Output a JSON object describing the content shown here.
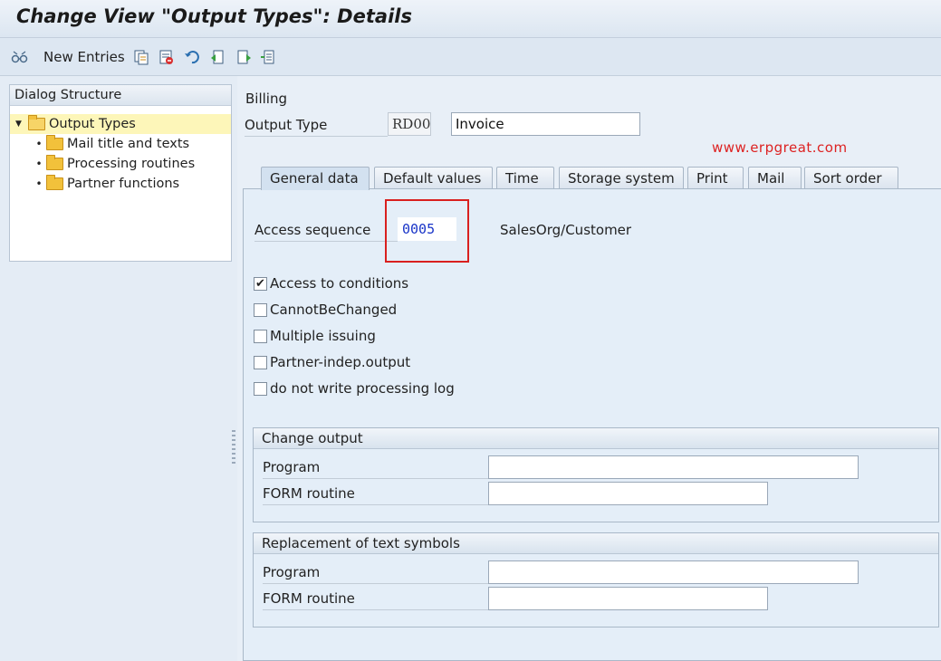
{
  "window": {
    "title": "Change View \"Output Types\": Details"
  },
  "toolbar": {
    "new_entries_label": "New Entries",
    "icons": [
      "glasses-change-icon",
      "copy-icon",
      "delete-icon",
      "undo-icon",
      "previous-entry-icon",
      "next-entry-icon",
      "select-all-icon"
    ]
  },
  "dialog_structure": {
    "header": "Dialog Structure",
    "items": [
      {
        "label": "Output Types",
        "level": 0,
        "selected": true,
        "expanded": true
      },
      {
        "label": "Mail title and texts",
        "level": 1
      },
      {
        "label": "Processing routines",
        "level": 1
      },
      {
        "label": "Partner functions",
        "level": 1
      }
    ]
  },
  "header": {
    "application": "Billing",
    "output_type_label": "Output Type",
    "output_type_code": "RD00",
    "output_type_desc": "Invoice"
  },
  "watermark": "www.erpgreat.com",
  "tabs": [
    {
      "label": "General data",
      "active": true
    },
    {
      "label": "Default values"
    },
    {
      "label": "Time"
    },
    {
      "label": "Storage system"
    },
    {
      "label": "Print"
    },
    {
      "label": "Mail"
    },
    {
      "label": "Sort order"
    }
  ],
  "general": {
    "access_sequence_label": "Access sequence",
    "access_sequence_value": "0005",
    "access_sequence_desc": "SalesOrg/Customer",
    "checkboxes": [
      {
        "label": "Access to conditions",
        "checked": true
      },
      {
        "label": "CannotBeChanged",
        "checked": false
      },
      {
        "label": "Multiple issuing",
        "checked": false
      },
      {
        "label": "Partner-indep.output",
        "checked": false
      },
      {
        "label": "do not write processing log",
        "checked": false
      }
    ]
  },
  "change_output": {
    "title": "Change output",
    "program_label": "Program",
    "program_value": "",
    "form_label": "FORM routine",
    "form_value": ""
  },
  "replacement": {
    "title": "Replacement of text symbols",
    "program_label": "Program",
    "program_value": "",
    "form_label": "FORM routine",
    "form_value": ""
  },
  "colors": {
    "highlight_box": "#d9201f",
    "watermark": "#dd2222",
    "value_blue": "#1a35c8"
  }
}
